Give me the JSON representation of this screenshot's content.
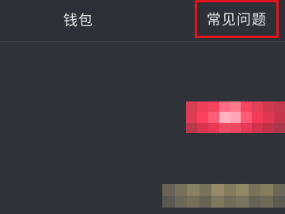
{
  "header": {
    "title": "钱包",
    "faq_label": "常见问题"
  },
  "content": {
    "blurred_action": "pixelated-red-button",
    "blurred_text": "pixelated-text-strip"
  },
  "colors": {
    "background": "#2f3238",
    "header_text": "#e6e6e6",
    "highlight_border": "#e0141b",
    "accent_red": "#f43f5e"
  }
}
